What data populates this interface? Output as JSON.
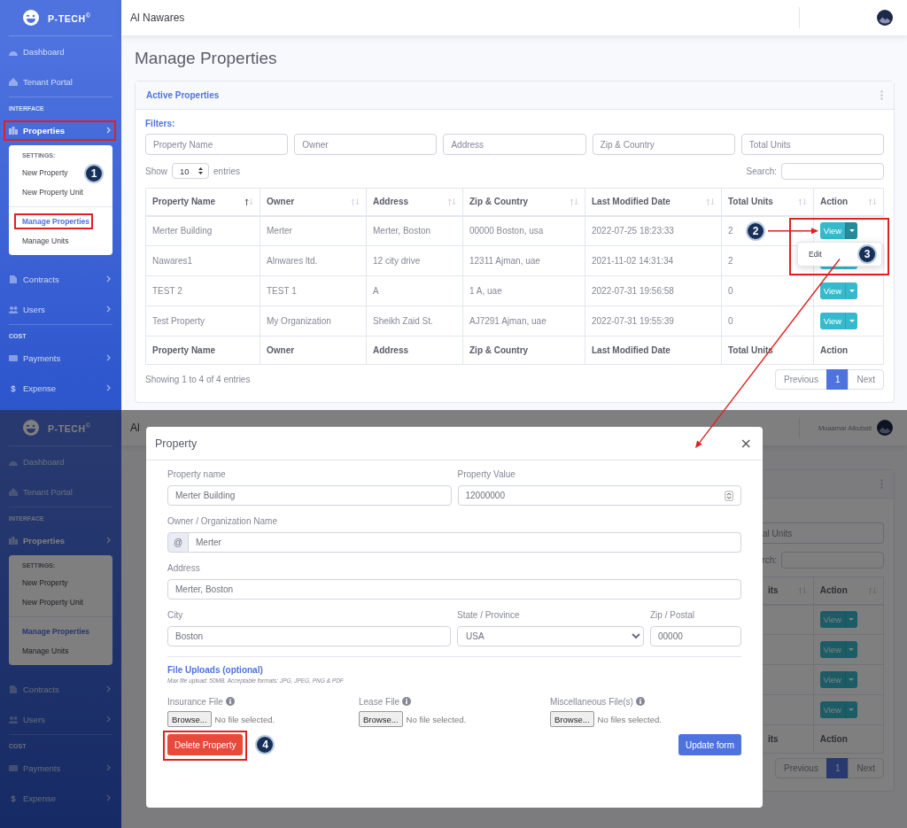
{
  "top_screen": {
    "sidebar": {
      "brand": "P-TECH$^{©}$",
      "sections": [
        {
          "items": [
            {
              "label": "Dashboard",
              "expanded": false,
              "highlighted": false
            },
            {
              "label": "Tenant Portal",
              "expanded": false,
              "highlighted": false
            }
          ]
        },
        {
          "heading": "INTERFACE",
          "items": [
            {
              "label": "Properties",
              "expandable": true,
              "expanded": true,
              "highlighted": true,
              "submenu": {
                "heading": "SETTINGS:",
                "step": "1",
                "groups": [
                  {
                    "items": [
                      {
                        "label": "New Property",
                        "selected": false,
                        "highlighted": false
                      },
                      {
                        "label": "New Property Unit",
                        "selected": false,
                        "highlighted": false
                      }
                    ]
                  },
                  {
                    "items": [
                      {
                        "label": "Manage Properties",
                        "selected": true,
                        "highlighted": true
                      },
                      {
                        "label": "Manage Units",
                        "selected": false,
                        "highlighted": false
                      }
                    ]
                  }
                ]
              }
            },
            {
              "label": "Contracts",
              "expandable": true,
              "expanded": false,
              "highlighted": false
            },
            {
              "label": "Users",
              "expandable": true,
              "expanded": false,
              "highlighted": false
            }
          ]
        },
        {
          "heading": "COST",
          "items": [
            {
              "label": "Payments",
              "expandable": true,
              "expanded": false,
              "highlighted": false
            },
            {
              "label": "Expense",
              "glyph": "$",
              "expandable": true,
              "expanded": false,
              "highlighted": false
            }
          ]
        }
      ]
    },
    "topbar": {
      "title": "Al Nawares"
    },
    "page_title": "Manage Properties",
    "card": {
      "kind": "full",
      "title": "Active Properties",
      "filters_label": "Filters:",
      "filters": [
        {
          "placeholder": "Property Name"
        },
        {
          "placeholder": "Owner"
        },
        {
          "placeholder": "Address"
        },
        {
          "placeholder": "Zip & Country"
        },
        {
          "placeholder": "Total Units"
        }
      ],
      "length": {
        "before": "Show",
        "value": "10",
        "after": "entries"
      },
      "search_label": "Search:",
      "columns": [
        {
          "label": "Property Name",
          "sorted": true
        },
        {
          "label": "Owner",
          "sorted": false
        },
        {
          "label": "Address",
          "sorted": false
        },
        {
          "label": "Zip & Country",
          "sorted": false
        },
        {
          "label": "Last Modified Date",
          "sorted": false
        },
        {
          "label": "Total Units",
          "sorted": false
        },
        {
          "label": "Action",
          "sorted": false
        }
      ],
      "rows": [
        {
          "cells": [
            "Merter Building",
            "Merter",
            "Merter, Boston",
            "00000 Boston, usa",
            "2022-07-25 18:23:33",
            "2"
          ],
          "action": {
            "label": "View",
            "menu_open": true,
            "menu": [
              "Edit"
            ],
            "step": "2",
            "menu_step": "3",
            "highlighted": true
          }
        },
        {
          "cells": [
            "Nawares1",
            "Alnwares ltd.",
            "12 city drive",
            "12311 Ajman, uae",
            "2021-11-02 14:31:34",
            "2"
          ],
          "action": {
            "menu_open": false
          }
        },
        {
          "cells": [
            "TEST 2",
            "TEST 1",
            "A",
            "1 A, uae",
            "2022-07-31 19:56:58",
            "0"
          ],
          "action": {
            "label": "View",
            "menu_open": false
          }
        },
        {
          "cells": [
            "Test Property",
            "My Organization",
            "Sheikh Zaid St.",
            "AJ7291 Ajman, uae",
            "2022-07-31 19:55:39",
            "0"
          ],
          "action": {
            "label": "View",
            "menu_open": false
          }
        }
      ],
      "footer": [
        "Property Name",
        "Owner",
        "Address",
        "Zip & Country",
        "Last Modified Date",
        "Total Units",
        "Action"
      ],
      "info": "Showing 1 to 4 of 4 entries",
      "pagination": [
        {
          "label": "Previous",
          "selected": false
        },
        {
          "label": "1",
          "selected": true
        },
        {
          "label": "Next",
          "selected": false
        }
      ]
    }
  },
  "bottom_screen": {
    "sidebar": {
      "brand": "P-TECH$^{©}$",
      "sections": [
        {
          "items": [
            {
              "label": "Dashboard",
              "expanded": false,
              "highlighted": false
            },
            {
              "label": "Tenant Portal",
              "expanded": false,
              "highlighted": false
            }
          ]
        },
        {
          "heading": "INTERFACE",
          "items": [
            {
              "label": "Properties",
              "expandable": true,
              "expanded": true,
              "highlighted": false,
              "submenu": {
                "heading": "SETTINGS:",
                "groups": [
                  {
                    "items": [
                      {
                        "label": "New Property",
                        "selected": false,
                        "highlighted": false
                      },
                      {
                        "label": "New Property Unit",
                        "selected": false,
                        "highlighted": false
                      }
                    ]
                  },
                  {
                    "items": [
                      {
                        "label": "Manage Properties",
                        "selected": true,
                        "highlighted": false
                      },
                      {
                        "label": "Manage Units",
                        "selected": false,
                        "highlighted": false
                      }
                    ]
                  }
                ]
              }
            },
            {
              "label": "Contracts",
              "expandable": true,
              "expanded": false,
              "highlighted": false
            },
            {
              "label": "Users",
              "expandable": true,
              "expanded": false,
              "highlighted": false
            }
          ]
        },
        {
          "heading": "COST",
          "items": [
            {
              "label": "Payments",
              "expandable": true,
              "expanded": false,
              "highlighted": false
            },
            {
              "label": "Expense",
              "glyph": "$",
              "expandable": true,
              "expanded": false,
              "highlighted": false
            }
          ]
        }
      ]
    },
    "topbar": {
      "title": "Al",
      "user": "Muaamar Alkubati"
    },
    "card": {
      "kind": "fragment",
      "filters": [
        {
          "placeholder": "al Units"
        }
      ],
      "search_label": "rch:",
      "columns": [
        {
          "label": "its",
          "sorted": false
        },
        {
          "label": "Action",
          "sorted": false
        }
      ],
      "rows": [
        {
          "action": {
            "label": "View",
            "menu_open": false
          }
        },
        {
          "action": {
            "label": "View",
            "menu_open": false
          }
        },
        {
          "action": {
            "label": "View",
            "menu_open": false
          }
        },
        {
          "action": {
            "label": "View",
            "menu_open": false
          }
        }
      ],
      "footer": [
        "its",
        "Action"
      ],
      "pagination": [
        {
          "label": "Previous",
          "selected": false
        },
        {
          "label": "1",
          "selected": true
        },
        {
          "label": "Next",
          "selected": false
        }
      ]
    },
    "modal": {
      "title": "Property",
      "close": "×",
      "rows": [
        {
          "fields": [
            {
              "kind": "text",
              "label": "Property name",
              "value": "Merter Building"
            },
            {
              "kind": "number",
              "label": "Property Value",
              "value": "12000000"
            }
          ]
        },
        {
          "fields": [
            {
              "kind": "addon",
              "label": "Owner / Organization Name",
              "addon": "@",
              "value": "Merter"
            }
          ]
        },
        {
          "fields": [
            {
              "kind": "text",
              "label": "Address",
              "value": "Merter, Boston"
            }
          ]
        },
        {
          "fields": [
            {
              "kind": "text",
              "label": "City",
              "value": "Boston"
            },
            {
              "kind": "select",
              "label": "State / Province",
              "value": "USA"
            },
            {
              "kind": "text",
              "label": "Zip / Postal",
              "value": "00000"
            }
          ]
        }
      ],
      "uploads": {
        "title": "File Uploads (optional)",
        "note": "Max file upload: 50MB. Acceptable formats: JPG, JPEG, PNG & PDF",
        "files": [
          {
            "label": "Insurance File",
            "button": "Browse...",
            "status": "No file selected."
          },
          {
            "label": "Lease File",
            "button": "Browse...",
            "status": "No file selected."
          },
          {
            "label": "Miscellaneous File(s)",
            "button": "Browse...",
            "status": "No files selected."
          }
        ]
      },
      "delete_button": {
        "label": "Delete Property",
        "highlighted": true,
        "step": "4"
      },
      "submit_button": {
        "label": "Update form"
      }
    }
  }
}
